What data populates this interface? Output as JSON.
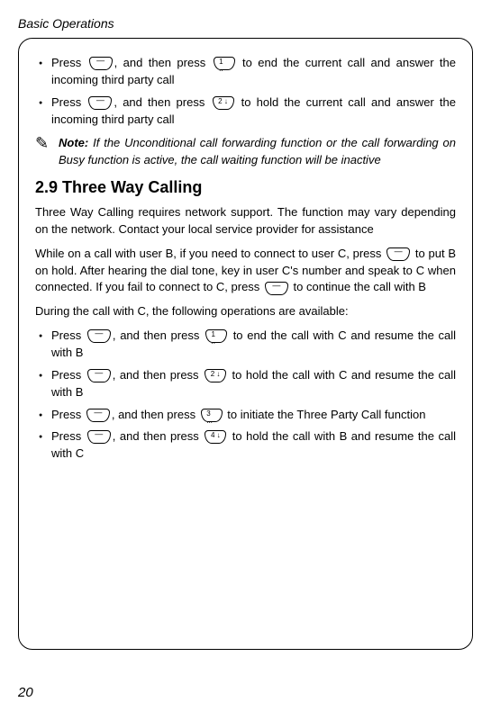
{
  "header": "Basic Operations",
  "items_top": [
    {
      "pre": "Press ",
      "key1_type": "dash",
      "mid1": ", and then press ",
      "key2_type": "num",
      "key2_label": "1 ..",
      "post": " to end the current call and answer the incoming third party call"
    },
    {
      "pre": "Press ",
      "key1_type": "dash",
      "mid1": ", and then press ",
      "key2_type": "num",
      "key2_label": "2 ↓",
      "post": " to hold the current call and answer the incoming third party call"
    }
  ],
  "note": {
    "icon": "✎",
    "label": "Note:",
    "text": " If the Unconditional call forwarding function or the call forwarding on Busy function is active, the call waiting function will be inactive"
  },
  "section_heading": "2.9 Three Way Calling",
  "para1": "Three Way Calling requires network support. The function may vary depending on the network. Contact your local service provider for assistance",
  "para2_a": "While on a call with user B, if you need to connect to user C, press ",
  "para2_b": " to put B on hold. After hearing the dial tone, key in user C's number and speak to C when connected. If you fail to connect to C, press ",
  "para2_c": " to continue the call with B",
  "para3": "During the call with C, the following operations are available:",
  "items_bottom": [
    {
      "pre": "Press ",
      "key1_type": "dash",
      "mid1": ", and then press ",
      "key2_type": "num",
      "key2_label": "1 ..",
      "post": " to end the call with C and resume the call with B"
    },
    {
      "pre": "Press ",
      "key1_type": "dash",
      "mid1": ", and then press ",
      "key2_type": "num",
      "key2_label": "2 ↓",
      "post": " to hold the call with C and resume the call with B"
    },
    {
      "pre": "Press ",
      "key1_type": "dash",
      "mid1": ", and then press ",
      "key2_type": "num",
      "key2_label": "3 ...",
      "post": " to initiate the Three Party Call function"
    },
    {
      "pre": "Press ",
      "key1_type": "dash",
      "mid1": ", and then press ",
      "key2_type": "num",
      "key2_label": "4 ↓",
      "post": " to hold the call with B and resume the call with C"
    }
  ],
  "page_number": "20"
}
